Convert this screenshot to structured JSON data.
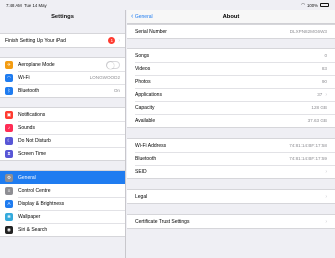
{
  "status": {
    "time": "7:48 AM",
    "date": "Tue 14 May",
    "battery": "100%"
  },
  "sidebar": {
    "title": "Settings",
    "setup": {
      "label": "Finish Setting Up Your iPad",
      "badge": "1"
    },
    "connectivity": [
      {
        "label": "Aeroplane Mode",
        "icon": "airplane-icon",
        "color": "#f39c12",
        "toggle": true
      },
      {
        "label": "Wi-Fi",
        "icon": "wifi-icon",
        "color": "#1f7cf0",
        "value": "LONGWOOD2"
      },
      {
        "label": "Bluetooth",
        "icon": "bluetooth-icon",
        "color": "#1f7cf0",
        "value": "On"
      }
    ],
    "alerts": [
      {
        "label": "Notifications",
        "icon": "notifications-icon",
        "color": "#ff3b30"
      },
      {
        "label": "Sounds",
        "icon": "sounds-icon",
        "color": "#ff2d55"
      },
      {
        "label": "Do Not Disturb",
        "icon": "moon-icon",
        "color": "#5856d6"
      },
      {
        "label": "Screen Time",
        "icon": "hourglass-icon",
        "color": "#5856d6"
      }
    ],
    "system": [
      {
        "label": "General",
        "icon": "gear-icon",
        "color": "#8e8e93",
        "selected": true
      },
      {
        "label": "Control Centre",
        "icon": "control-centre-icon",
        "color": "#8e8e93"
      },
      {
        "label": "Display & Brightness",
        "icon": "display-icon",
        "color": "#1f7cf0"
      },
      {
        "label": "Wallpaper",
        "icon": "wallpaper-icon",
        "color": "#34aadc"
      },
      {
        "label": "Siri & Search",
        "icon": "siri-icon",
        "color": "#222222"
      }
    ]
  },
  "detail": {
    "back_label": "General",
    "title": "About",
    "serial": {
      "label": "Serial Number",
      "value": "DLXPN82MG6W3"
    },
    "media": [
      {
        "label": "Songs",
        "value": "0"
      },
      {
        "label": "Videos",
        "value": "83"
      },
      {
        "label": "Photos",
        "value": "90"
      },
      {
        "label": "Applications",
        "value": "37",
        "chevron": true
      },
      {
        "label": "Capacity",
        "value": "128 GB"
      },
      {
        "label": "Available",
        "value": "37.63 GB"
      }
    ],
    "network": [
      {
        "label": "Wi-Fi Address",
        "value": "74:81:14:BF:17:58"
      },
      {
        "label": "Bluetooth",
        "value": "74:81:14:BF:17:59"
      },
      {
        "label": "SEID",
        "value": "",
        "chevron": true
      }
    ],
    "legal": {
      "label": "Legal"
    },
    "certificate": {
      "label": "Certificate Trust Settings"
    }
  }
}
